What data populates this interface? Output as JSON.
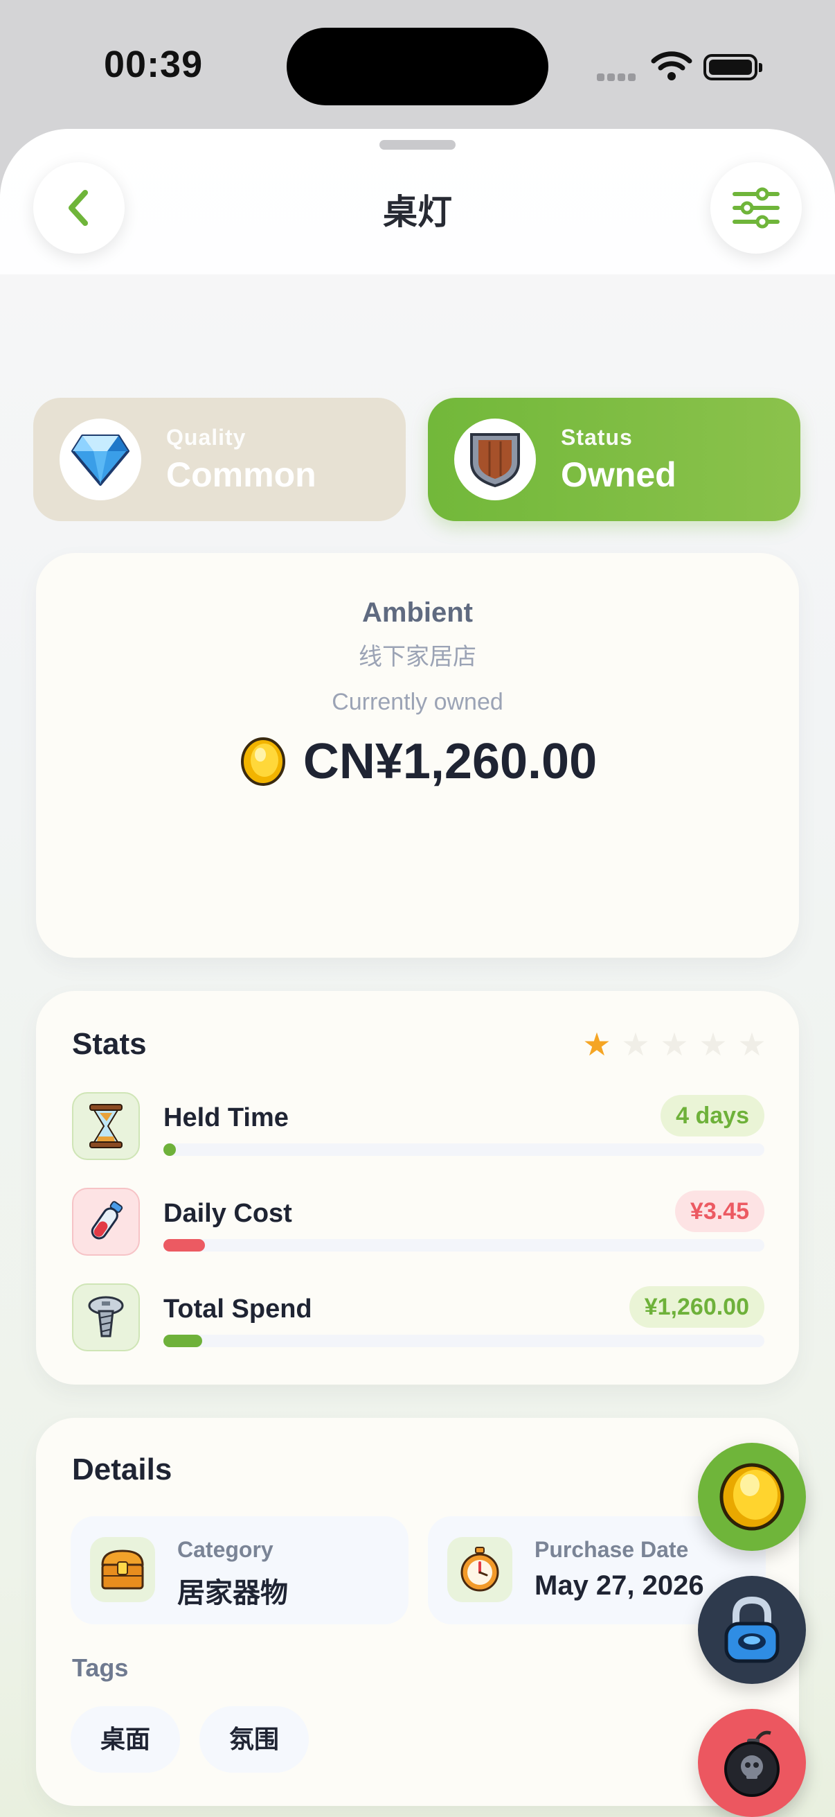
{
  "status_bar": {
    "time": "00:39"
  },
  "header": {
    "title": "桌灯",
    "back_icon": "chevron-left-icon",
    "filter_icon": "sliders-icon"
  },
  "pills": {
    "quality": {
      "label": "Quality",
      "value": "Common",
      "icon": "diamond-icon"
    },
    "status": {
      "label": "Status",
      "value": "Owned",
      "icon": "shield-icon"
    }
  },
  "summary": {
    "brand": "Ambient",
    "store": "线下家居店",
    "state": "Currently owned",
    "price": "CN¥1,260.00",
    "icon": "coin-icon"
  },
  "stats": {
    "title": "Stats",
    "rating": 1,
    "rating_max": 5,
    "rows": [
      {
        "label": "Held Time",
        "value": "4 days",
        "tone": "green",
        "progress": 0.01,
        "icon": "hourglass-icon"
      },
      {
        "label": "Daily Cost",
        "value": "¥3.45",
        "tone": "red",
        "progress": 0.04,
        "icon": "potion-icon"
      },
      {
        "label": "Total Spend",
        "value": "¥1,260.00",
        "tone": "green",
        "progress": 0.04,
        "icon": "screw-icon"
      }
    ]
  },
  "details": {
    "title": "Details",
    "category": {
      "label": "Category",
      "value": "居家器物",
      "icon": "treasure-chest-icon"
    },
    "purchase_date": {
      "label": "Purchase Date",
      "value": "May 27, 2026",
      "icon": "stopwatch-icon"
    },
    "tags_title": "Tags",
    "tags": [
      "桌面",
      "氛围"
    ]
  },
  "fabs": [
    "coin-icon",
    "lock-icon",
    "bomb-icon"
  ],
  "colors": {
    "accent_green": "#72b83a",
    "danger_red": "#ec5760",
    "navy": "#2e3a4d"
  }
}
